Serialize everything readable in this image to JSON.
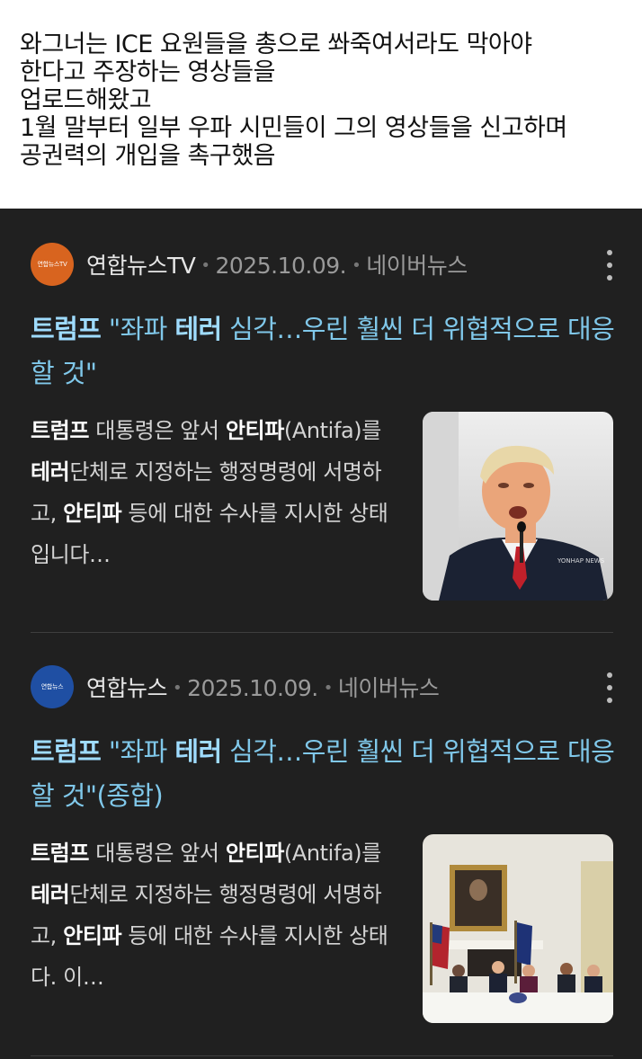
{
  "caption": {
    "lines": [
      "와그너는 ICE 요원들을 총으로 쏴죽여서라도 막아야",
      "한다고 주장하는 영상들을",
      "업로드해왔고",
      "1월 말부터 일부 우파 시민들이 그의 영상들을 신고하며",
      "공권력의 개입을 촉구했음"
    ]
  },
  "colors": {
    "card_bg": "#202020",
    "headline": "#80c8ea",
    "logo_yonhap_tv": "#d8641f",
    "logo_yonhap": "#1f4fa3"
  },
  "articles": [
    {
      "logo_text": "연합뉴스TV",
      "source": "연합뉴스TV",
      "date": "2025.10.09.",
      "platform": "네이버뉴스",
      "menu_icon": "more-vertical-icon",
      "headline": {
        "kw1": "트럼프",
        "t1": " \"좌파 ",
        "kw2": "테러",
        "t2": " 심각…우린 훨씬 더 위협적으로 대응할 것\""
      },
      "summary": {
        "kw1": "트럼프",
        "t1": " 대통령은 앞서 ",
        "kw2": "안티파",
        "t2": "(Antifa)를 ",
        "kw3": "테러",
        "t3": "단체로 지정하는 행정명령에 서명하고, ",
        "kw4": "안티파",
        "t4": " 등에 대한 수사를 지시한 상태입니다…"
      },
      "thumb_watermark": "YONHAP NEWS"
    },
    {
      "logo_text": "연합뉴스",
      "source": "연합뉴스",
      "date": "2025.10.09.",
      "platform": "네이버뉴스",
      "menu_icon": "more-vertical-icon",
      "headline": {
        "kw1": "트럼프",
        "t1": " \"좌파 ",
        "kw2": "테러",
        "t2": " 심각…우린 훨씬 더 위협적으로 대응할 것\"(종합)"
      },
      "summary": {
        "kw1": "트럼프",
        "t1": " 대통령은 앞서 ",
        "kw2": "안티파",
        "t2": "(Antifa)를 ",
        "kw3": "테러",
        "t3": "단체로 지정하는 행정명령에 서명하고, ",
        "kw4": "안티파",
        "t4": " 등에 대한 수사를 지시한 상태다. 이…"
      }
    }
  ]
}
